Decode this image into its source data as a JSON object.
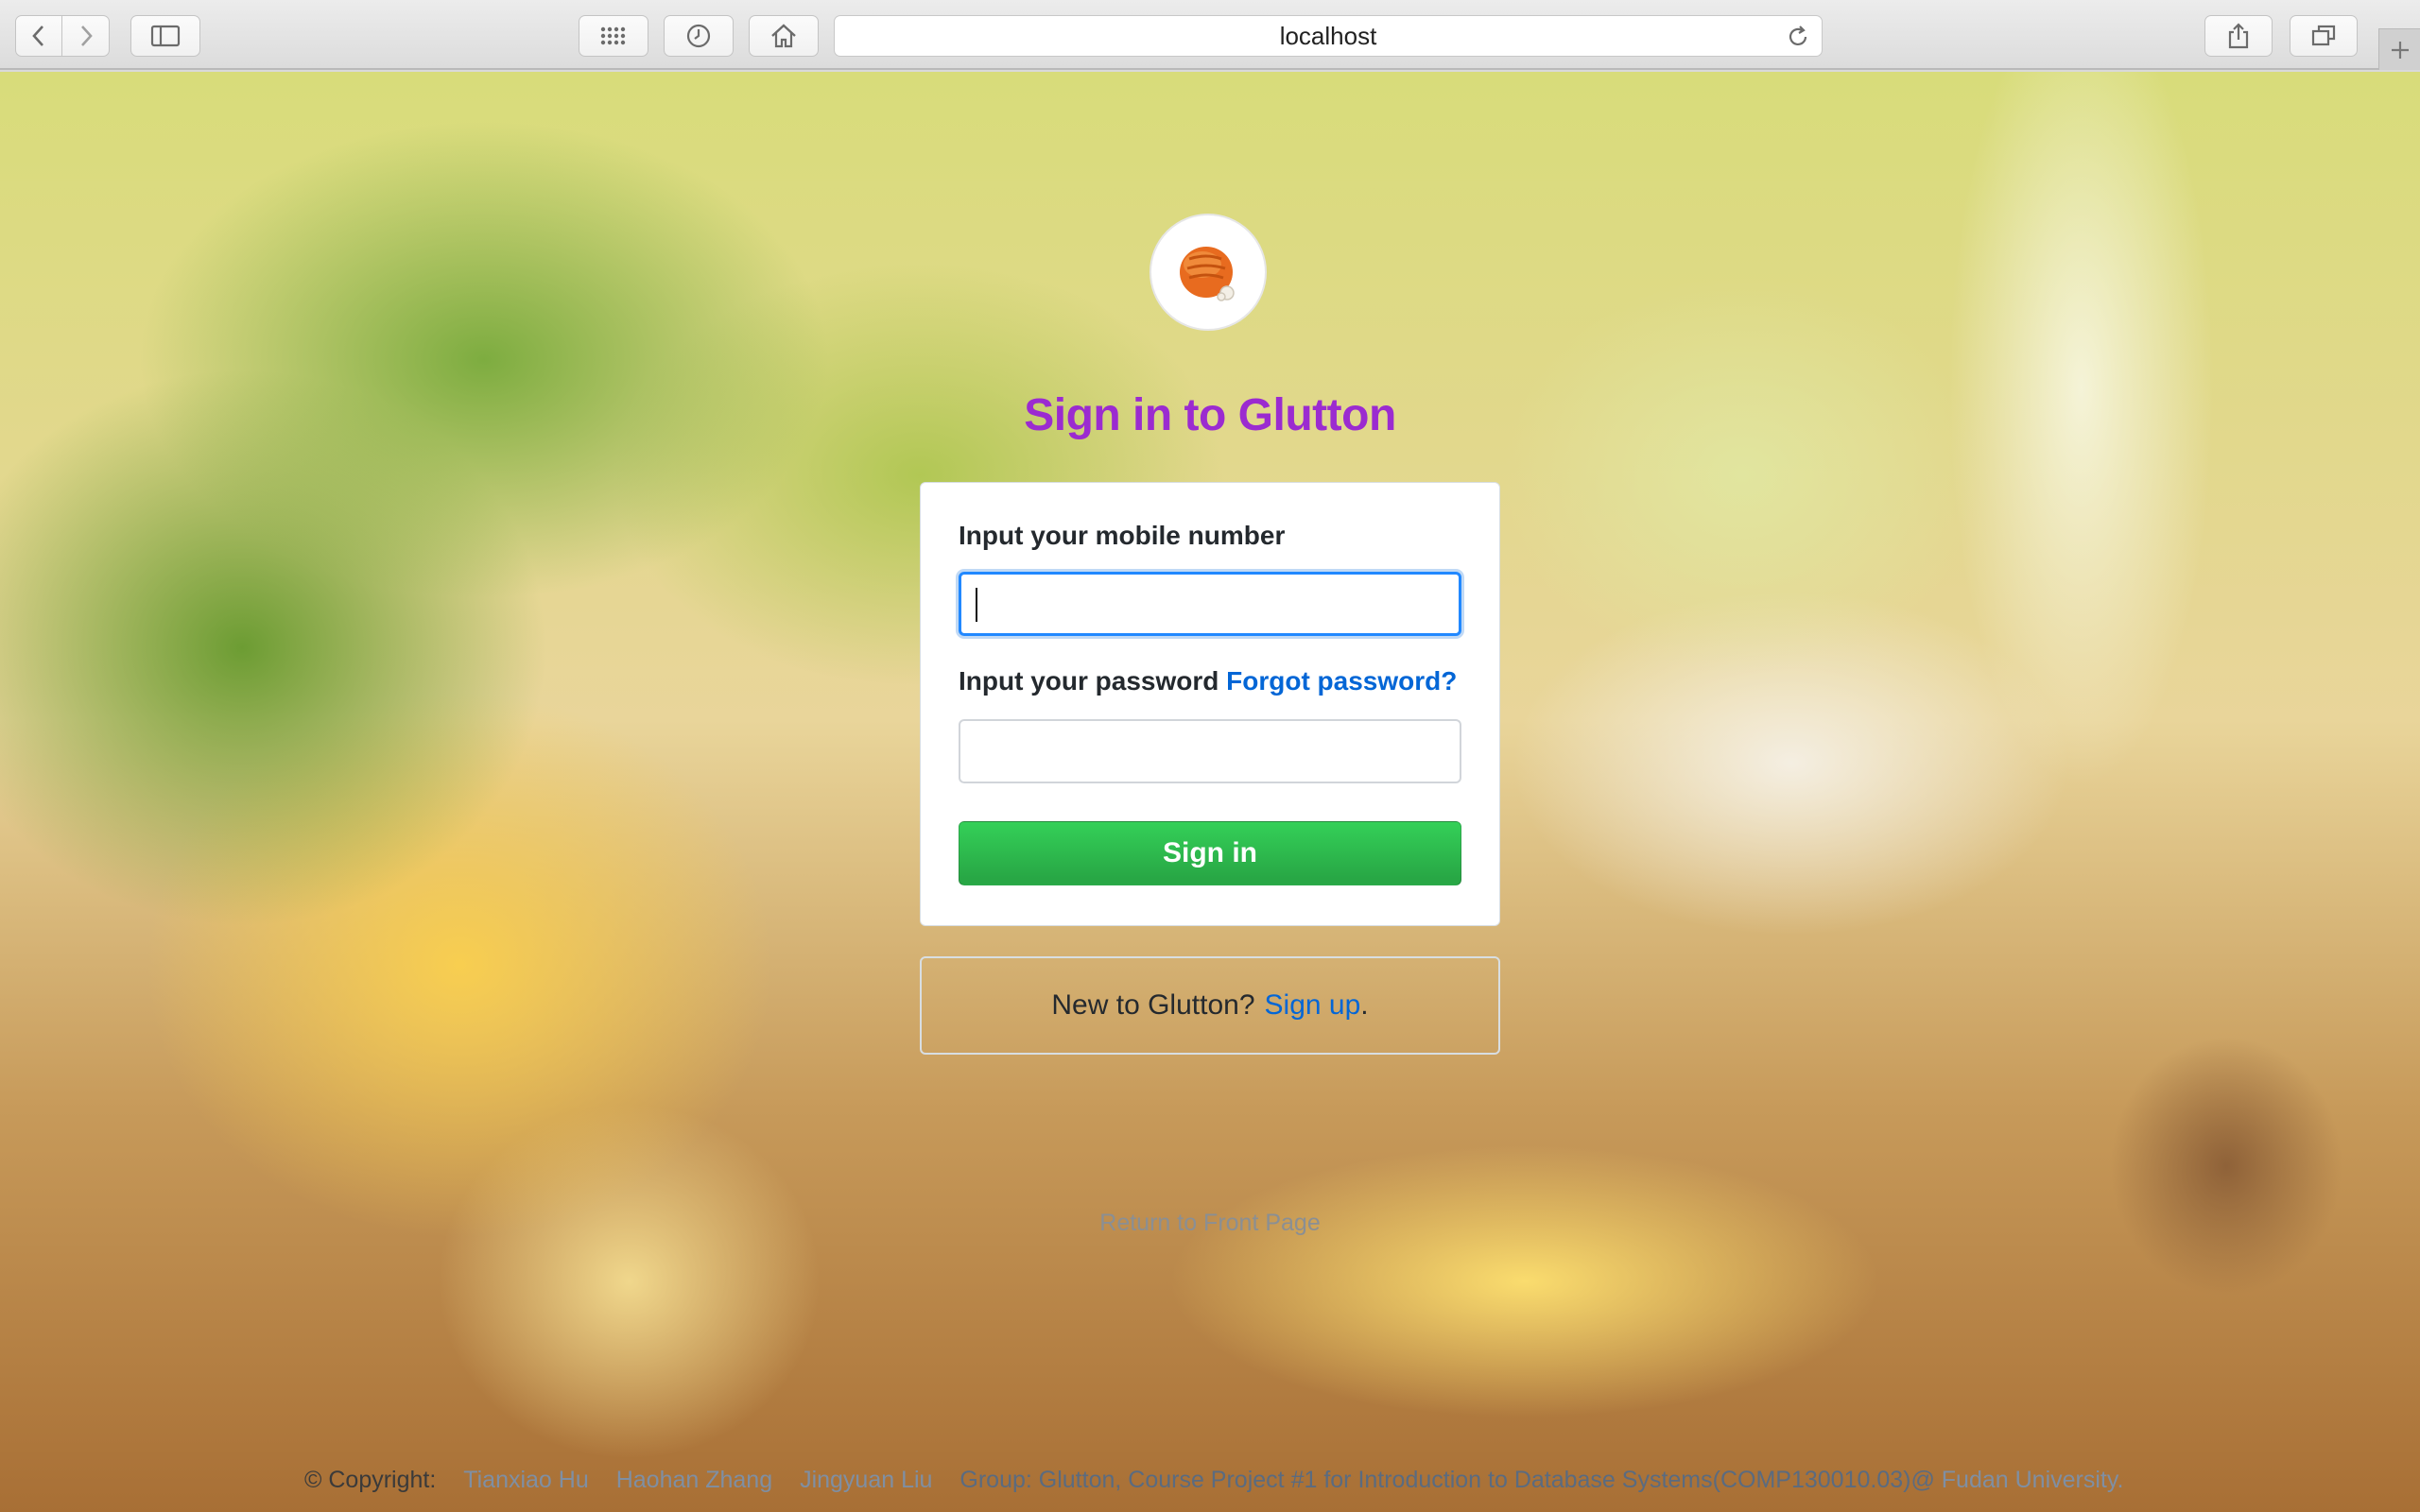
{
  "browser": {
    "url": "localhost",
    "icons": {
      "back": "chevron-left-icon",
      "forward": "chevron-right-icon",
      "sidebar": "sidebar-icon",
      "grid": "grid-icon",
      "history": "clock-icon",
      "home": "home-icon",
      "reload": "reload-icon",
      "share": "share-icon",
      "tabs": "tabs-icon",
      "new_tab": "plus-icon"
    }
  },
  "login": {
    "title": "Sign in to Glutton",
    "mobile_label": "Input your mobile number",
    "mobile_value": "",
    "password_label": "Input your password",
    "forgot_password": "Forgot password?",
    "password_value": "",
    "signin_button": "Sign in",
    "new_prompt": "New to Glutton?",
    "signup_link": "Sign up",
    "signup_suffix": ".",
    "return_link": "Return to Front Page"
  },
  "footer": {
    "copyright": "© Copyright:",
    "authors": [
      "Tianxiao Hu",
      "Haohan Zhang",
      "Jingyuan Liu"
    ],
    "description": "Group: Glutton, Course Project #1 for Introduction to Database Systems(COMP130010.03)@",
    "university": " Fudan University."
  },
  "colors": {
    "title": "#9b2bd0",
    "link": "#0366d6",
    "button": "#28a745",
    "focus": "#2188ff"
  }
}
